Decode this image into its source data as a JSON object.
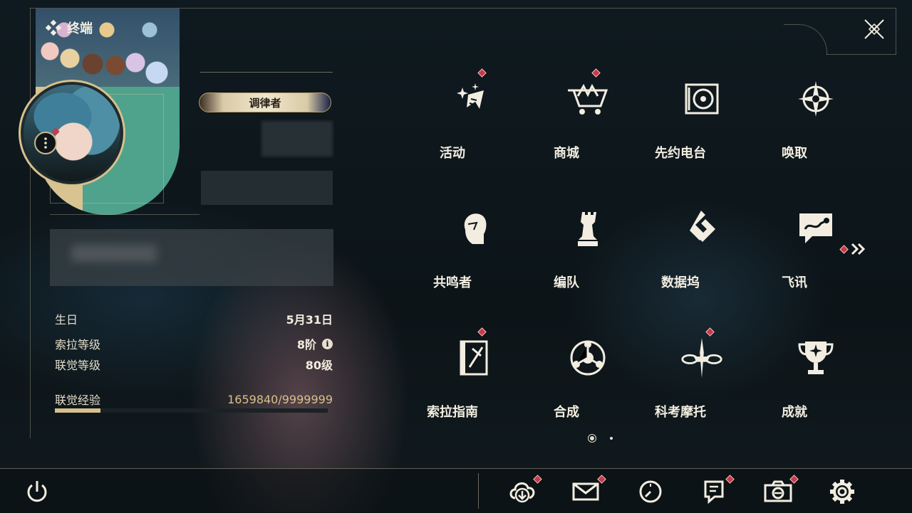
{
  "header": {
    "title": "终端"
  },
  "profile": {
    "title_badge": "调律者",
    "stats": [
      {
        "label": "生日",
        "value": "5月31日"
      },
      {
        "label": "索拉等级",
        "value": "8阶"
      },
      {
        "label": "联觉等级",
        "value": "80级"
      }
    ],
    "exp": {
      "label": "联觉经验",
      "value": "1659840/9999999",
      "progress": 0.166
    }
  },
  "menu": {
    "items": [
      {
        "label": "活动",
        "icon": "sparkle-flag-icon",
        "badge": true
      },
      {
        "label": "商城",
        "icon": "shopping-cart-icon",
        "badge": true
      },
      {
        "label": "先约电台",
        "icon": "radio-speaker-icon",
        "badge": false
      },
      {
        "label": "唤取",
        "icon": "compass-star-icon",
        "badge": false
      },
      {
        "label": "共鸣者",
        "icon": "character-head-icon",
        "badge": false
      },
      {
        "label": "编队",
        "icon": "chess-piece-icon",
        "badge": false
      },
      {
        "label": "数据坞",
        "icon": "data-dock-icon",
        "badge": false
      },
      {
        "label": "飞讯",
        "icon": "chat-bubble-icon",
        "badge": false
      },
      {
        "label": "索拉指南",
        "icon": "guide-book-icon",
        "badge": true
      },
      {
        "label": "合成",
        "icon": "synthesis-ring-icon",
        "badge": false
      },
      {
        "label": "科考摩托",
        "icon": "motorbike-icon",
        "badge": true
      },
      {
        "label": "成就",
        "icon": "trophy-icon",
        "badge": false
      }
    ]
  },
  "bottom_bar": {
    "left": {
      "icon": "power-icon"
    },
    "right": [
      {
        "icon": "cloud-download-icon",
        "badge": true
      },
      {
        "icon": "mail-icon",
        "badge": true
      },
      {
        "icon": "clock-icon",
        "badge": false
      },
      {
        "icon": "notice-icon",
        "badge": true
      },
      {
        "icon": "camera-icon",
        "badge": true
      },
      {
        "icon": "settings-gear-icon",
        "badge": false
      }
    ]
  },
  "colors": {
    "accent": "#d6c08c",
    "badge": "#c83a4a",
    "text": "#f2ede0"
  }
}
